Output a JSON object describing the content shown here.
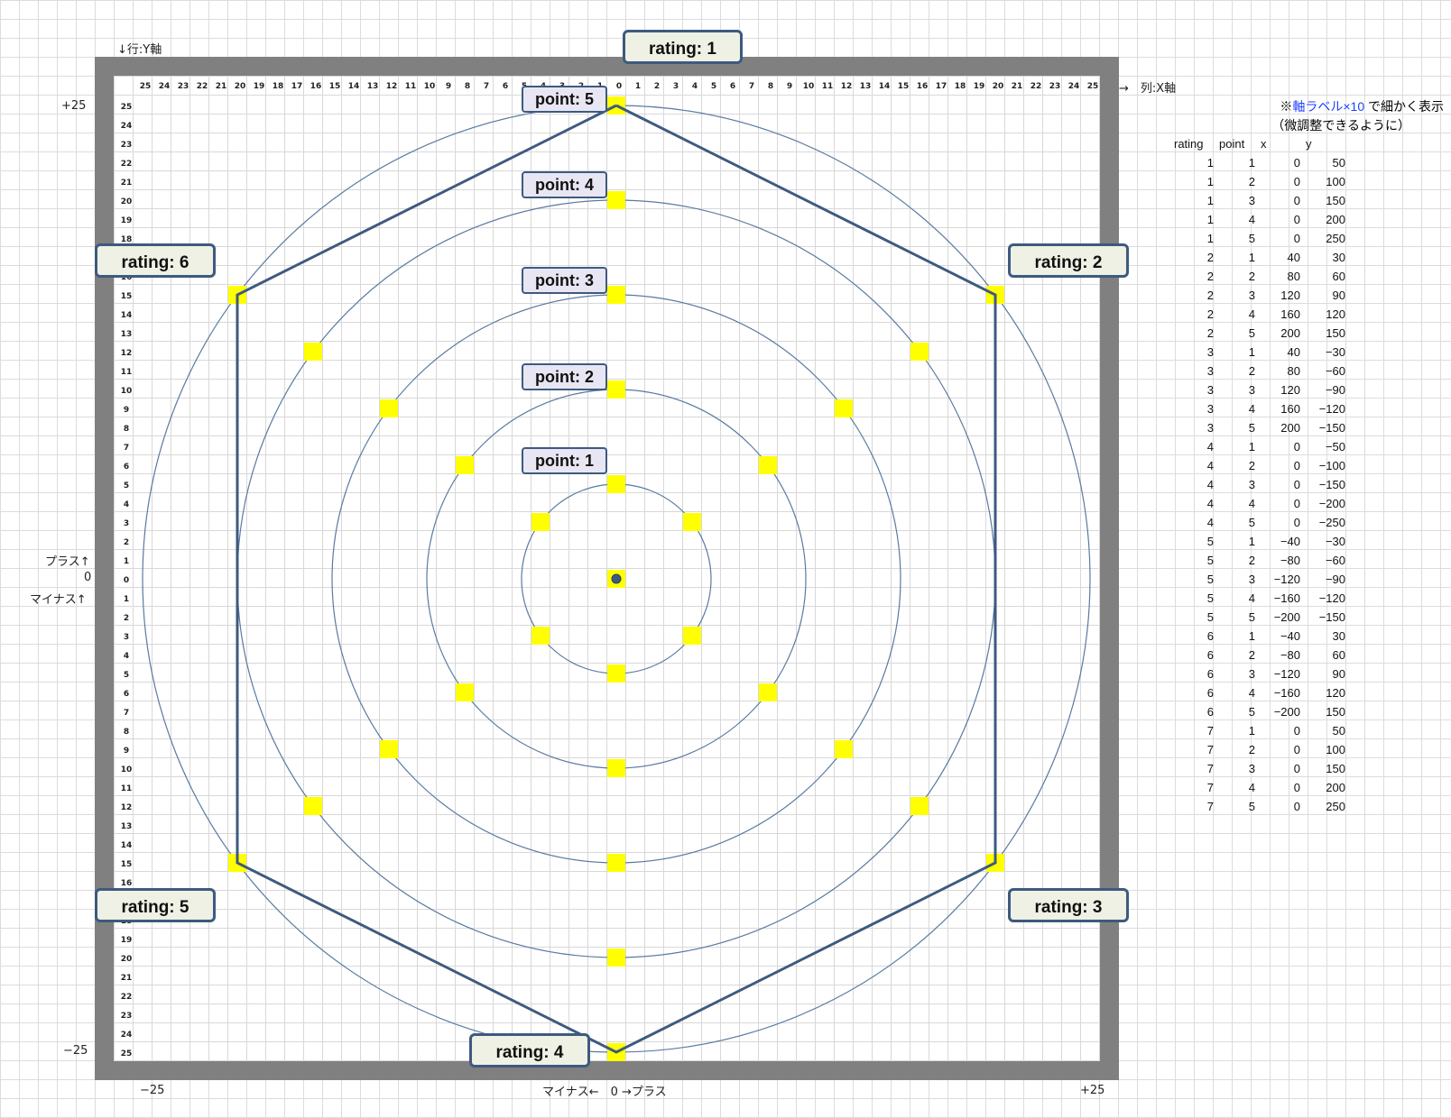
{
  "labels": {
    "y_axis_header": "↓行:Y軸",
    "x_axis_header": "→　列:X軸",
    "top_left_value": "+25",
    "bottom_left_value": "−25",
    "left_plus": "プラス↑",
    "left_zero": "0",
    "left_minus": "マイナス↑",
    "bottom_left": "−25",
    "bottom_center": "マイナス←　0 →プラス",
    "bottom_right": "+25",
    "note_prefix": "※",
    "note_highlight": "軸ラベル×10",
    "note_suffix": "で細かく表示",
    "note_line2": "（微調整できるように）"
  },
  "axis_ticks": {
    "top": [
      "25",
      "24",
      "23",
      "22",
      "21",
      "20",
      "19",
      "18",
      "17",
      "16",
      "15",
      "14",
      "13",
      "12",
      "11",
      "10",
      "9",
      "8",
      "7",
      "6",
      "5",
      "4",
      "3",
      "2",
      "1",
      "0",
      "1",
      "2",
      "3",
      "4",
      "5",
      "6",
      "7",
      "8",
      "9",
      "10",
      "11",
      "12",
      "13",
      "14",
      "15",
      "16",
      "17",
      "18",
      "19",
      "20",
      "21",
      "22",
      "23",
      "24",
      "25"
    ],
    "left": [
      "25",
      "24",
      "23",
      "22",
      "21",
      "20",
      "19",
      "18",
      "17",
      "16",
      "15",
      "14",
      "13",
      "12",
      "11",
      "10",
      "9",
      "8",
      "7",
      "6",
      "5",
      "4",
      "3",
      "2",
      "1",
      "0",
      "1",
      "2",
      "3",
      "4",
      "5",
      "6",
      "7",
      "8",
      "9",
      "10",
      "11",
      "12",
      "13",
      "14",
      "15",
      "16",
      "17",
      "18",
      "19",
      "20",
      "21",
      "22",
      "23",
      "24",
      "25"
    ]
  },
  "rating_labels": [
    "rating: 1",
    "rating: 2",
    "rating: 3",
    "rating: 4",
    "rating: 5",
    "rating: 6"
  ],
  "point_labels": [
    "point: 1",
    "point: 2",
    "point: 3",
    "point: 4",
    "point: 5"
  ],
  "table": {
    "headers": [
      "rating",
      "point",
      "x",
      "y"
    ],
    "rows": [
      [
        "1",
        "1",
        "0",
        "50"
      ],
      [
        "1",
        "2",
        "0",
        "100"
      ],
      [
        "1",
        "3",
        "0",
        "150"
      ],
      [
        "1",
        "4",
        "0",
        "200"
      ],
      [
        "1",
        "5",
        "0",
        "250"
      ],
      [
        "2",
        "1",
        "40",
        "30"
      ],
      [
        "2",
        "2",
        "80",
        "60"
      ],
      [
        "2",
        "3",
        "120",
        "90"
      ],
      [
        "2",
        "4",
        "160",
        "120"
      ],
      [
        "2",
        "5",
        "200",
        "150"
      ],
      [
        "3",
        "1",
        "40",
        "−30"
      ],
      [
        "3",
        "2",
        "80",
        "−60"
      ],
      [
        "3",
        "3",
        "120",
        "−90"
      ],
      [
        "3",
        "4",
        "160",
        "−120"
      ],
      [
        "3",
        "5",
        "200",
        "−150"
      ],
      [
        "4",
        "1",
        "0",
        "−50"
      ],
      [
        "4",
        "2",
        "0",
        "−100"
      ],
      [
        "4",
        "3",
        "0",
        "−150"
      ],
      [
        "4",
        "4",
        "0",
        "−200"
      ],
      [
        "4",
        "5",
        "0",
        "−250"
      ],
      [
        "5",
        "1",
        "−40",
        "−30"
      ],
      [
        "5",
        "2",
        "−80",
        "−60"
      ],
      [
        "5",
        "3",
        "−120",
        "−90"
      ],
      [
        "5",
        "4",
        "−160",
        "−120"
      ],
      [
        "5",
        "5",
        "−200",
        "−150"
      ],
      [
        "6",
        "1",
        "−40",
        "30"
      ],
      [
        "6",
        "2",
        "−80",
        "60"
      ],
      [
        "6",
        "3",
        "−120",
        "90"
      ],
      [
        "6",
        "4",
        "−160",
        "120"
      ],
      [
        "6",
        "5",
        "−200",
        "150"
      ],
      [
        "7",
        "1",
        "0",
        "50"
      ],
      [
        "7",
        "2",
        "0",
        "100"
      ],
      [
        "7",
        "3",
        "0",
        "150"
      ],
      [
        "7",
        "4",
        "0",
        "200"
      ],
      [
        "7",
        "5",
        "0",
        "250"
      ]
    ]
  },
  "colors": {
    "frame": "#808080",
    "polygon": "#3d5a80",
    "circle": "#5a7aa0",
    "marker": "#ffff00",
    "note_highlight": "#1f3fff"
  },
  "chart_data": {
    "type": "scatter",
    "x_range": [
      -250,
      250
    ],
    "y_range": [
      -250,
      250
    ],
    "circle_radii": [
      50,
      100,
      150,
      200,
      250
    ],
    "points": [
      {
        "x": 0,
        "y": 0
      },
      {
        "x": 0,
        "y": 50
      },
      {
        "x": 0,
        "y": 100
      },
      {
        "x": 0,
        "y": 150
      },
      {
        "x": 0,
        "y": 200
      },
      {
        "x": 0,
        "y": 250
      },
      {
        "x": 40,
        "y": 30
      },
      {
        "x": 80,
        "y": 60
      },
      {
        "x": 120,
        "y": 90
      },
      {
        "x": 160,
        "y": 120
      },
      {
        "x": 200,
        "y": 150
      },
      {
        "x": 40,
        "y": -30
      },
      {
        "x": 80,
        "y": -60
      },
      {
        "x": 120,
        "y": -90
      },
      {
        "x": 160,
        "y": -120
      },
      {
        "x": 200,
        "y": -150
      },
      {
        "x": 0,
        "y": -50
      },
      {
        "x": 0,
        "y": -100
      },
      {
        "x": 0,
        "y": -150
      },
      {
        "x": 0,
        "y": -200
      },
      {
        "x": 0,
        "y": -250
      },
      {
        "x": -40,
        "y": -30
      },
      {
        "x": -80,
        "y": -60
      },
      {
        "x": -120,
        "y": -90
      },
      {
        "x": -160,
        "y": -120
      },
      {
        "x": -200,
        "y": -150
      },
      {
        "x": -40,
        "y": 30
      },
      {
        "x": -80,
        "y": 60
      },
      {
        "x": -120,
        "y": 90
      },
      {
        "x": -160,
        "y": 120
      },
      {
        "x": -200,
        "y": 150
      }
    ],
    "polygon": [
      [
        0,
        250
      ],
      [
        200,
        150
      ],
      [
        200,
        -150
      ],
      [
        0,
        -250
      ],
      [
        -200,
        -150
      ],
      [
        -200,
        150
      ],
      [
        0,
        250
      ]
    ]
  }
}
